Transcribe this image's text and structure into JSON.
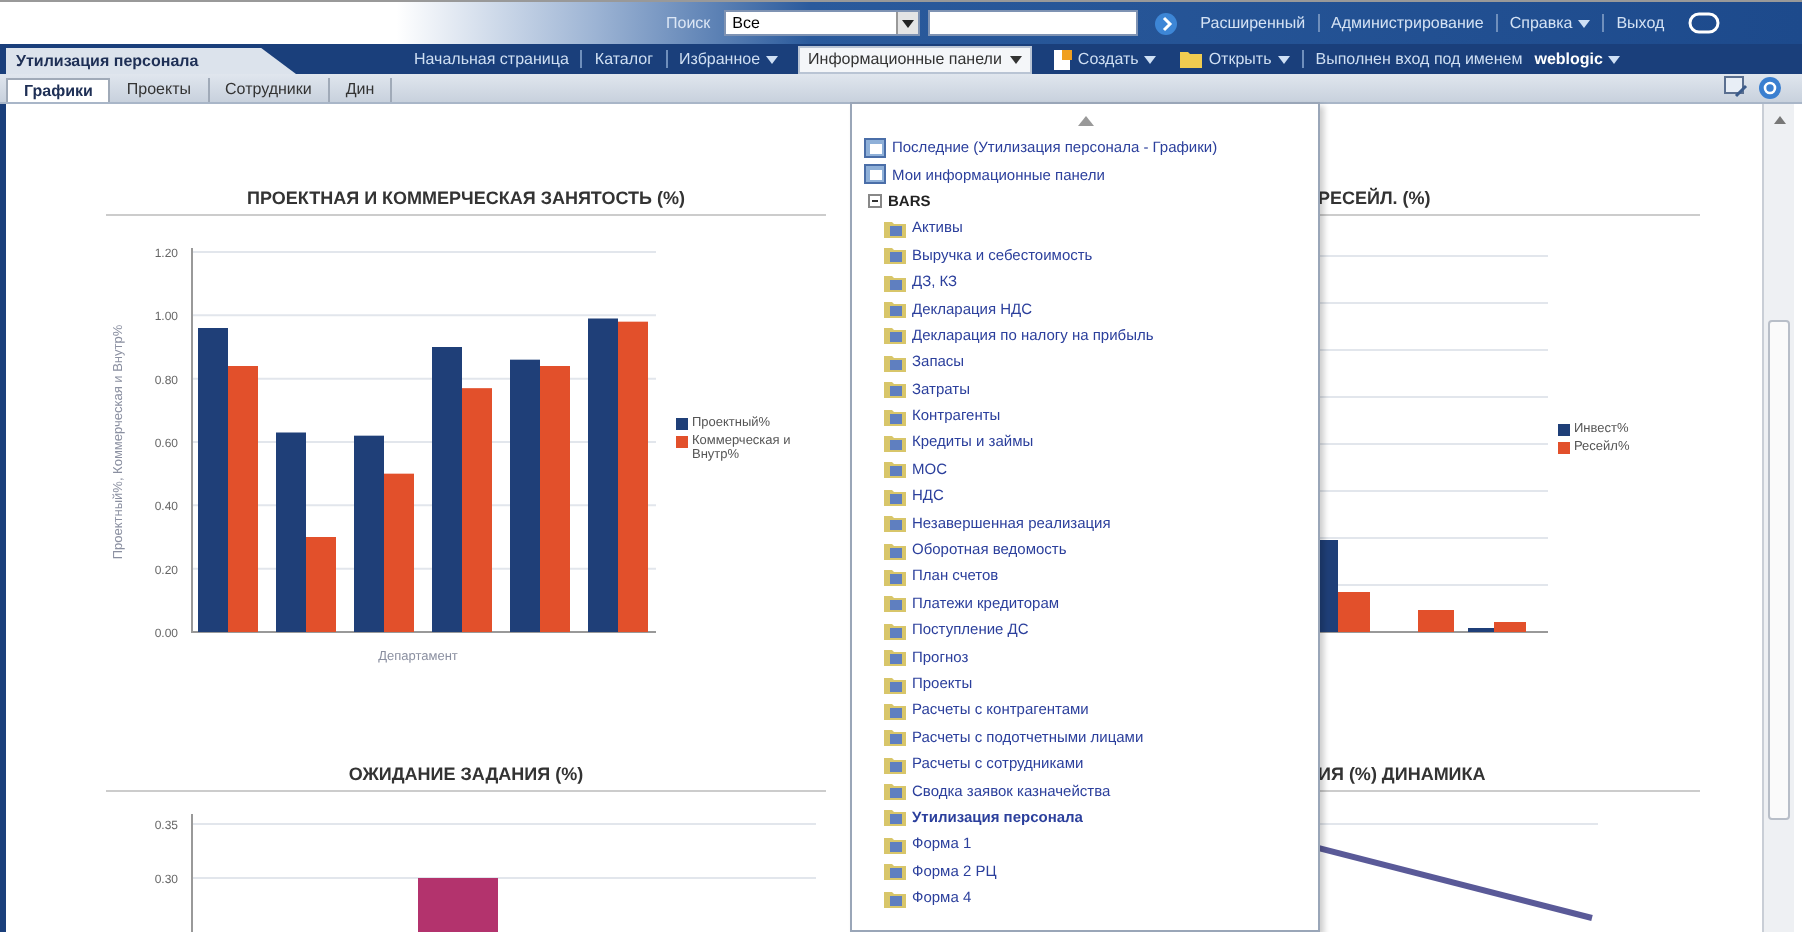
{
  "header": {
    "search_label": "Поиск",
    "search_scope": "Все",
    "links": [
      {
        "label": "Расширенный",
        "dropdown": false
      },
      {
        "label": "Администрирование",
        "dropdown": false
      },
      {
        "label": "Справка",
        "dropdown": true
      },
      {
        "label": "Выход",
        "dropdown": false
      }
    ]
  },
  "navbar": {
    "dashboard_title": "Утилизация персонала",
    "links": [
      {
        "label": "Начальная страница",
        "dropdown": false
      },
      {
        "label": "Каталог",
        "dropdown": false
      },
      {
        "label": "Избранное",
        "dropdown": true
      }
    ],
    "dashboards_button": {
      "label": "Информационные панели",
      "expanded": true
    },
    "create": "Создать",
    "open": "Открыть",
    "signed_in": "Выполнен вход под именем",
    "user": "weblogic"
  },
  "page_tabs": [
    {
      "label": "Графики",
      "selected": true
    },
    {
      "label": "Проекты",
      "selected": false
    },
    {
      "label": "Сотрудники",
      "selected": false
    },
    {
      "label": "Дин",
      "selected": false
    }
  ],
  "dashboards_menu": {
    "recent": "Последние (Утилизация персонала - Графики)",
    "my": "Мои информационные панели",
    "folder": {
      "label": "BARS",
      "expanded": true,
      "children": [
        {
          "label": "Активы",
          "current": false
        },
        {
          "label": "Выручка и себестоимость",
          "current": false
        },
        {
          "label": "ДЗ, КЗ",
          "current": false
        },
        {
          "label": "Декларация НДС",
          "current": false
        },
        {
          "label": "Декларация по налогу на прибыль",
          "current": false
        },
        {
          "label": "Запасы",
          "current": false
        },
        {
          "label": "Затраты",
          "current": false
        },
        {
          "label": "Контрагенты",
          "current": false
        },
        {
          "label": "Кредиты и займы",
          "current": false
        },
        {
          "label": "МОС",
          "current": false
        },
        {
          "label": "НДС",
          "current": false
        },
        {
          "label": "Незавершенная реализация",
          "current": false
        },
        {
          "label": "Оборотная ведомость",
          "current": false
        },
        {
          "label": "План счетов",
          "current": false
        },
        {
          "label": "Платежи кредиторам",
          "current": false
        },
        {
          "label": "Поступление ДС",
          "current": false
        },
        {
          "label": "Прогноз",
          "current": false
        },
        {
          "label": "Проекты",
          "current": false
        },
        {
          "label": "Расчеты с контрагентами",
          "current": false
        },
        {
          "label": "Расчеты с подотчетными лицами",
          "current": false
        },
        {
          "label": "Расчеты с сотрудниками",
          "current": false
        },
        {
          "label": "Сводка заявок казначейства",
          "current": false
        },
        {
          "label": "Утилизация персонала",
          "current": true
        },
        {
          "label": "Форма 1",
          "current": false
        },
        {
          "label": "Форма 2 РЦ",
          "current": false
        },
        {
          "label": "Форма 4",
          "current": false
        }
      ]
    }
  },
  "charts": [
    {
      "chart_data": {
        "type": "bar",
        "title": "ПРОЕКТНАЯ И КОММЕРЧЕСКАЯ ЗАНЯТОСТЬ (%)",
        "xlabel": "Департамент",
        "ylabel": "Проектный%, Коммерческая и Внутр%",
        "ylim": [
          0,
          1.2
        ],
        "grid": true,
        "legend": "right",
        "yticks": [
          {
            "value": 0,
            "label": "0.00"
          },
          {
            "value": 0.2,
            "label": "0.20"
          },
          {
            "value": 0.4,
            "label": "0.40"
          },
          {
            "value": 0.6,
            "label": "0.60"
          },
          {
            "value": 0.8,
            "label": "0.80"
          },
          {
            "value": 1,
            "label": "1.00"
          },
          {
            "value": 1.2,
            "label": "1.20"
          }
        ],
        "series": [
          {
            "name": "Проектный%",
            "color": "#1f3f78",
            "values": [
              0.96,
              0.63,
              0.62,
              0.9,
              0.86,
              0.99
            ]
          },
          {
            "name": "Коммерческая и Внутр%",
            "color": "#e2502b",
            "values": [
              0.84,
              0.3,
              0.5,
              0.77,
              0.84,
              0.98
            ]
          }
        ]
      }
    },
    {
      "title": "РЕСЕЙЛ. (%)",
      "legend": [
        {
          "label": "Инвест%",
          "color": "#1f3f78"
        },
        {
          "label": "Ресейл%",
          "color": "#e2502b"
        }
      ]
    },
    {
      "title": "ОЖИДАНИЕ ЗАДАНИЯ (%)",
      "axis_labels": [
        "0.35",
        "0.30"
      ]
    },
    {
      "title": "ИЯ (%) ДИНАМИКА"
    }
  ]
}
